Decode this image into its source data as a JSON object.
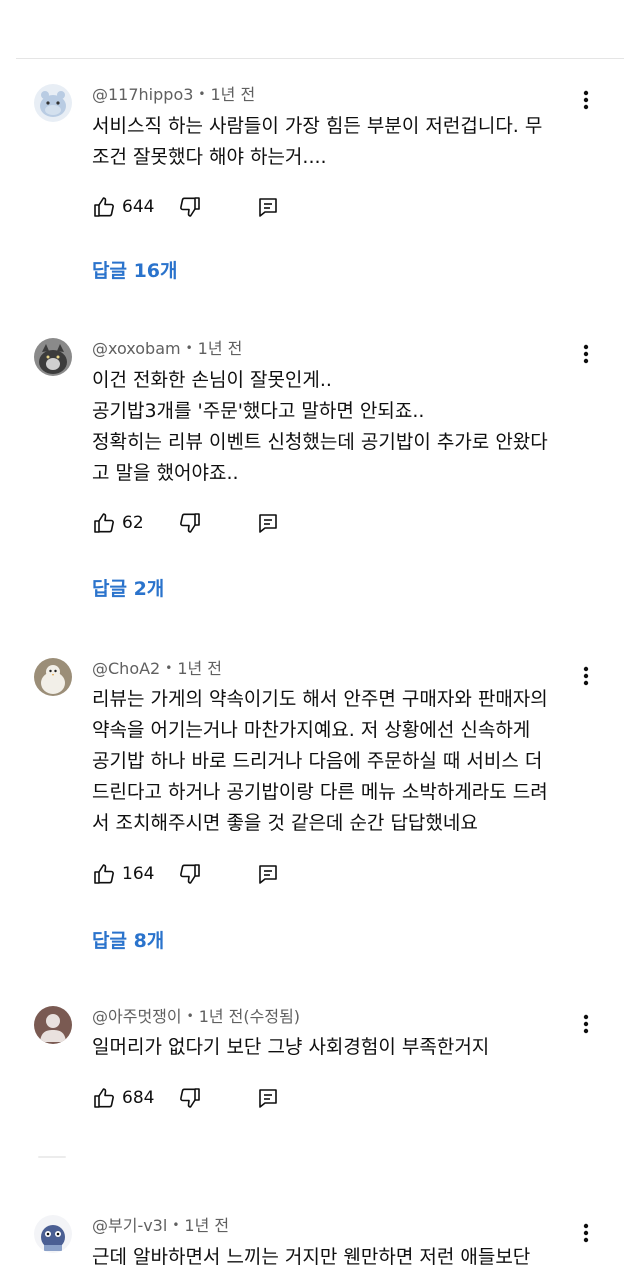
{
  "comments": [
    {
      "author": "@117hippo3",
      "time": "1년 전",
      "body": [
        "서비스직 하는 사람들이 가장 힘든 부분이 저런겁니다. 무",
        "조건 잘못했다 해야 하는거...."
      ],
      "likes": "644",
      "replies": "답글 16개",
      "avatar": "hippo-avatar"
    },
    {
      "author": "@xoxobam",
      "time": "1년 전",
      "body": [
        "이건 전화한 손님이 잘못인게..",
        "공기밥3개를 '주문'했다고 말하면 안되죠..",
        "정확히는 리뷰 이벤트 신청했는데 공기밥이 추가로 안왔다",
        "고 말을 했어야죠.."
      ],
      "likes": "62",
      "replies": "답글 2개",
      "avatar": "cat-avatar"
    },
    {
      "author": "@ChoA2",
      "time": "1년 전",
      "body": [
        "리뷰는 가게의 약속이기도 해서 안주면 구매자와 판매자의",
        "약속을 어기는거나 마찬가지예요. 저 상황에선 신속하게",
        "공기밥 하나 바로 드리거나 다음에 주문하실 때 서비스 더",
        "드린다고 하거나 공기밥이랑 다른 메뉴 소박하게라도 드려",
        "서 조치해주시면 좋을 것 같은데 순간 답답했네요"
      ],
      "likes": "164",
      "replies": "답글 8개",
      "avatar": "bird-avatar"
    },
    {
      "author": "@아주멋쟁이",
      "time": "1년 전(수정됨)",
      "body": [
        "일머리가 없다기 보단 그냥 사회경험이 부족한거지"
      ],
      "likes": "684",
      "replies": "",
      "avatar": "default-person-avatar"
    },
    {
      "author": "@부기-v3l",
      "time": "1년 전",
      "body": [
        "근데 알바하면서 느끼는 거지만 웬만하면 저런 애들보단"
      ],
      "likes": "",
      "replies": "",
      "avatar": "character-avatar"
    }
  ],
  "colors": {
    "link": "#2a73cc",
    "meta": "#606060",
    "text": "#0f0f0f"
  },
  "icons": [
    "thumb-up-icon",
    "thumb-down-icon",
    "reply-icon",
    "more-vert-icon"
  ]
}
